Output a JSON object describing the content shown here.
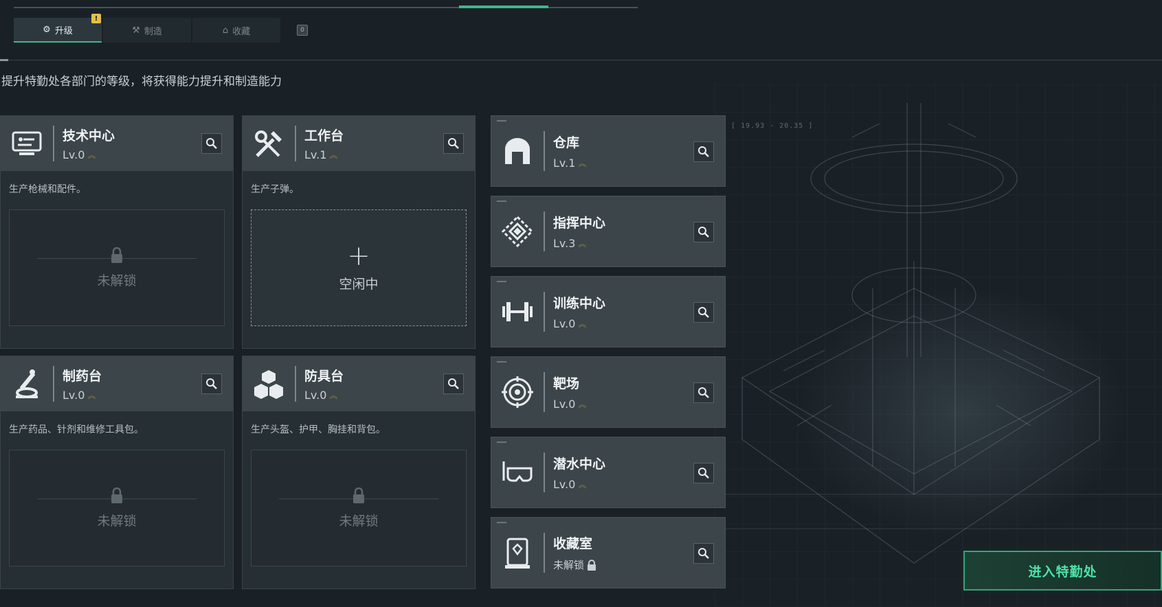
{
  "tabs": [
    {
      "label": "升级",
      "icon": "upgrade-icon",
      "active": true
    },
    {
      "label": "制造",
      "icon": "craft-icon",
      "active": false
    },
    {
      "label": "收藏",
      "icon": "collection-icon",
      "active": false
    }
  ],
  "tab_badge": "!",
  "key_hint": "0",
  "description": "提升特勤处各部门的等级，将获得能力提升和制造能力",
  "coord_readout": "[ 19.93 - 20.35 ]",
  "large_cards": [
    {
      "name": "技术中心",
      "level": "Lv.0",
      "icon": "tech-center-icon",
      "desc": "生产枪械和配件。",
      "slot_state": "未解锁",
      "slot_locked": true
    },
    {
      "name": "工作台",
      "level": "Lv.1",
      "icon": "workbench-icon",
      "desc": "生产子弹。",
      "slot_state": "空闲中",
      "slot_locked": false
    },
    {
      "name": "制药台",
      "level": "Lv.0",
      "icon": "pharmacy-icon",
      "desc": "生产药品、针剂和维修工具包。",
      "slot_state": "未解锁",
      "slot_locked": true
    },
    {
      "name": "防具台",
      "level": "Lv.0",
      "icon": "armor-bench-icon",
      "desc": "生产头盔、护甲、胸挂和背包。",
      "slot_state": "未解锁",
      "slot_locked": true
    }
  ],
  "small_cards": [
    {
      "name": "仓库",
      "level": "Lv.1",
      "icon": "warehouse-icon"
    },
    {
      "name": "指挥中心",
      "level": "Lv.3",
      "icon": "command-center-icon"
    },
    {
      "name": "训练中心",
      "level": "Lv.0",
      "icon": "training-center-icon"
    },
    {
      "name": "靶场",
      "level": "Lv.0",
      "icon": "shooting-range-icon"
    },
    {
      "name": "潜水中心",
      "level": "Lv.0",
      "icon": "diving-center-icon"
    },
    {
      "name": "收藏室",
      "level": "未解锁",
      "icon": "collection-room-icon",
      "locked": true
    }
  ],
  "enter_button": "进入特勤处",
  "colors": {
    "accent": "#3fb98a",
    "badge": "#e2c04a",
    "level_chevron": "#8a7a4a"
  }
}
